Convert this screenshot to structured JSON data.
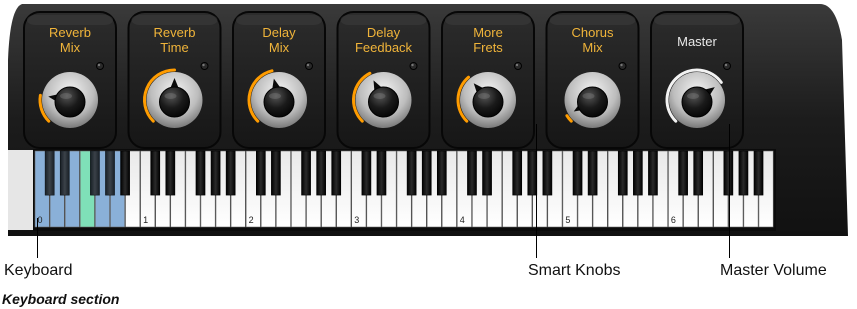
{
  "knobs": [
    {
      "label_line1": "Reverb",
      "label_line2": "Mix",
      "value": 0.2,
      "active": true
    },
    {
      "label_line1": "Reverb",
      "label_line2": "Time",
      "value": 0.5,
      "active": true
    },
    {
      "label_line1": "Delay",
      "label_line2": "Mix",
      "value": 0.45,
      "active": true
    },
    {
      "label_line1": "Delay",
      "label_line2": "Feedback",
      "value": 0.4,
      "active": true
    },
    {
      "label_line1": "More",
      "label_line2": "Frets",
      "value": 0.35,
      "active": true
    },
    {
      "label_line1": "Chorus",
      "label_line2": "Mix",
      "value": 0.05,
      "active": true
    },
    {
      "label_line1": "Master",
      "label_line2": "",
      "value": 0.7,
      "active": false
    }
  ],
  "keyboard": {
    "octave_labels": [
      "0",
      "1",
      "2",
      "3",
      "4",
      "5",
      "6"
    ],
    "highlighted_white_keys": 6,
    "pressed_key": 3
  },
  "callouts": {
    "keyboard": "Keyboard",
    "smart_knobs": "Smart Knobs",
    "master_volume": "Master Volume"
  },
  "caption": "Keyboard section",
  "colors": {
    "panel": "#1e1e1e",
    "knob_label": "#f0b43a",
    "master_label": "#e8e8e8",
    "arc": "#ff9c00",
    "master_arc": "#f2f2f2",
    "key_highlight": "#8ab0d8",
    "key_pressed": "#7fe0b8"
  }
}
